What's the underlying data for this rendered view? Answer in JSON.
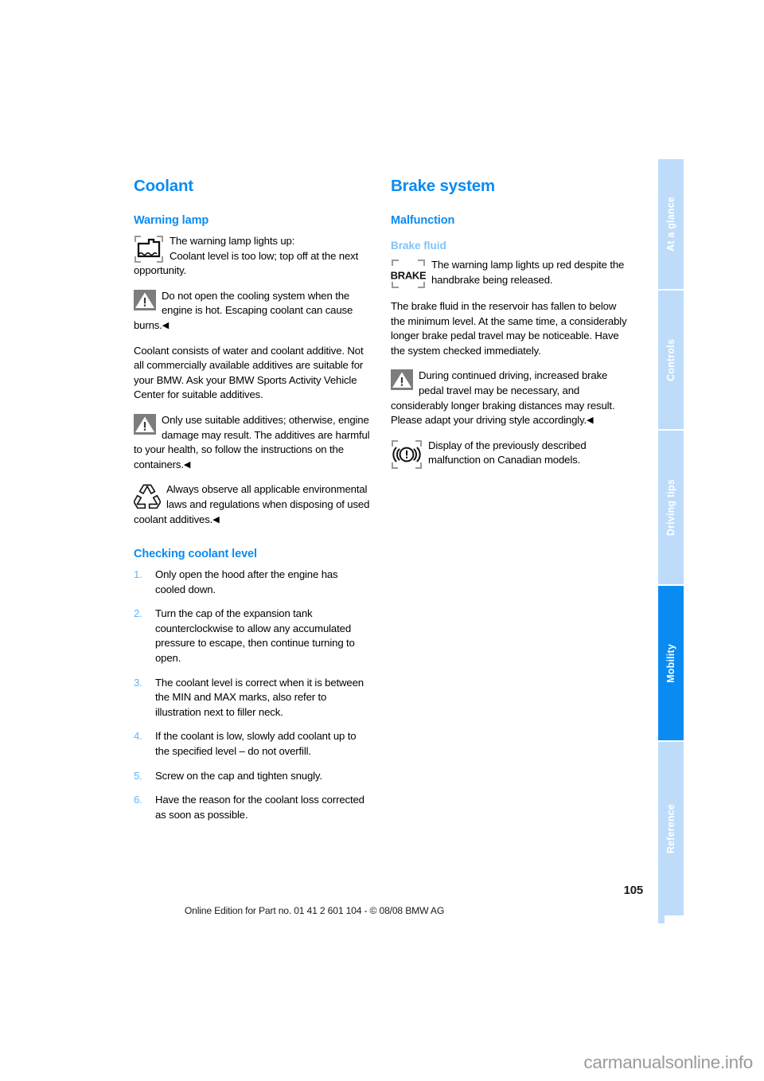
{
  "document": {
    "page_number": "105",
    "footer_text": "Online Edition for Part no. 01 41 2 601 104 - © 08/08 BMW AG",
    "watermark": "carmanualsonline.info"
  },
  "colors": {
    "heading_blue": "#0a8bf2",
    "subheading_blue": "#82c3f7",
    "tab_inactive": "#bedcfa",
    "tab_active": "#0a8bf2",
    "list_number": "#62b4f5"
  },
  "sidebar": {
    "tabs": [
      {
        "label": "At a glance",
        "active": false
      },
      {
        "label": "Controls",
        "active": false
      },
      {
        "label": "Driving tips",
        "active": false
      },
      {
        "label": "Mobility",
        "active": true
      },
      {
        "label": "Reference",
        "active": false
      }
    ]
  },
  "left_column": {
    "chapter_title": "Coolant",
    "section_warning_lamp": "Warning lamp",
    "note_coolant_lamp": {
      "icon": "coolant-level-warning-icon",
      "line1": "The warning lamp lights up:",
      "line2": "Coolant level is too low; top off at the next opportunity."
    },
    "note_hot_engine": {
      "icon": "warning-triangle-icon",
      "text": "Do not open the cooling system when the engine is hot. Escaping coolant can cause burns.",
      "end_marker": "◀"
    },
    "paragraph_additives": "Coolant consists of water and coolant additive. Not all commercially available additives are suitable for your BMW. Ask your BMW Sports Activity Vehicle Center for suitable additives.",
    "note_suitable_additives": {
      "icon": "warning-triangle-icon",
      "text": "Only use suitable additives; otherwise, engine damage may result. The additives are harmful to your health, so follow the instructions on the containers.",
      "end_marker": "◀"
    },
    "note_environment": {
      "icon": "recycling-icon",
      "text": "Always observe all applicable environmental laws and regulations when disposing of used coolant additives.",
      "end_marker": "◀"
    },
    "section_checking": "Checking coolant level",
    "steps": [
      {
        "num": "1.",
        "text": "Only open the hood after the engine has cooled down."
      },
      {
        "num": "2.",
        "text": "Turn the cap of the expansion tank counterclockwise to allow any accumulated pressure to escape, then continue turning to open."
      },
      {
        "num": "3.",
        "text": "The coolant level is correct when it is between the MIN and MAX marks, also refer to illustration next to filler neck."
      },
      {
        "num": "4.",
        "text": "If the coolant is low, slowly add coolant up to the specified level – do not overfill."
      },
      {
        "num": "5.",
        "text": "Screw on the cap and tighten snugly."
      },
      {
        "num": "6.",
        "text": "Have the reason for the coolant loss corrected as soon as possible."
      }
    ]
  },
  "right_column": {
    "chapter_title": "Brake system",
    "section_malfunction": "Malfunction",
    "subsection_brake_fluid": "Brake fluid",
    "note_brake_lamp": {
      "icon": "brake-warning-icon",
      "icon_text": "BRAKE",
      "text": "The warning lamp lights up red despite the handbrake being released."
    },
    "paragraph_reservoir": "The brake fluid in the reservoir has fallen to below the minimum level. At the same time, a considerably longer brake pedal travel may be noticeable. Have the system checked immediately.",
    "note_continued_driving": {
      "icon": "warning-triangle-icon",
      "text": "During continued driving, increased brake pedal travel may be necessary, and considerably longer braking distances may result. Please adapt your driving style accordingly.",
      "end_marker": "◀"
    },
    "note_canadian": {
      "icon": "brake-canadian-warning-icon",
      "text": "Display of the previously described malfunction on Canadian models."
    }
  }
}
